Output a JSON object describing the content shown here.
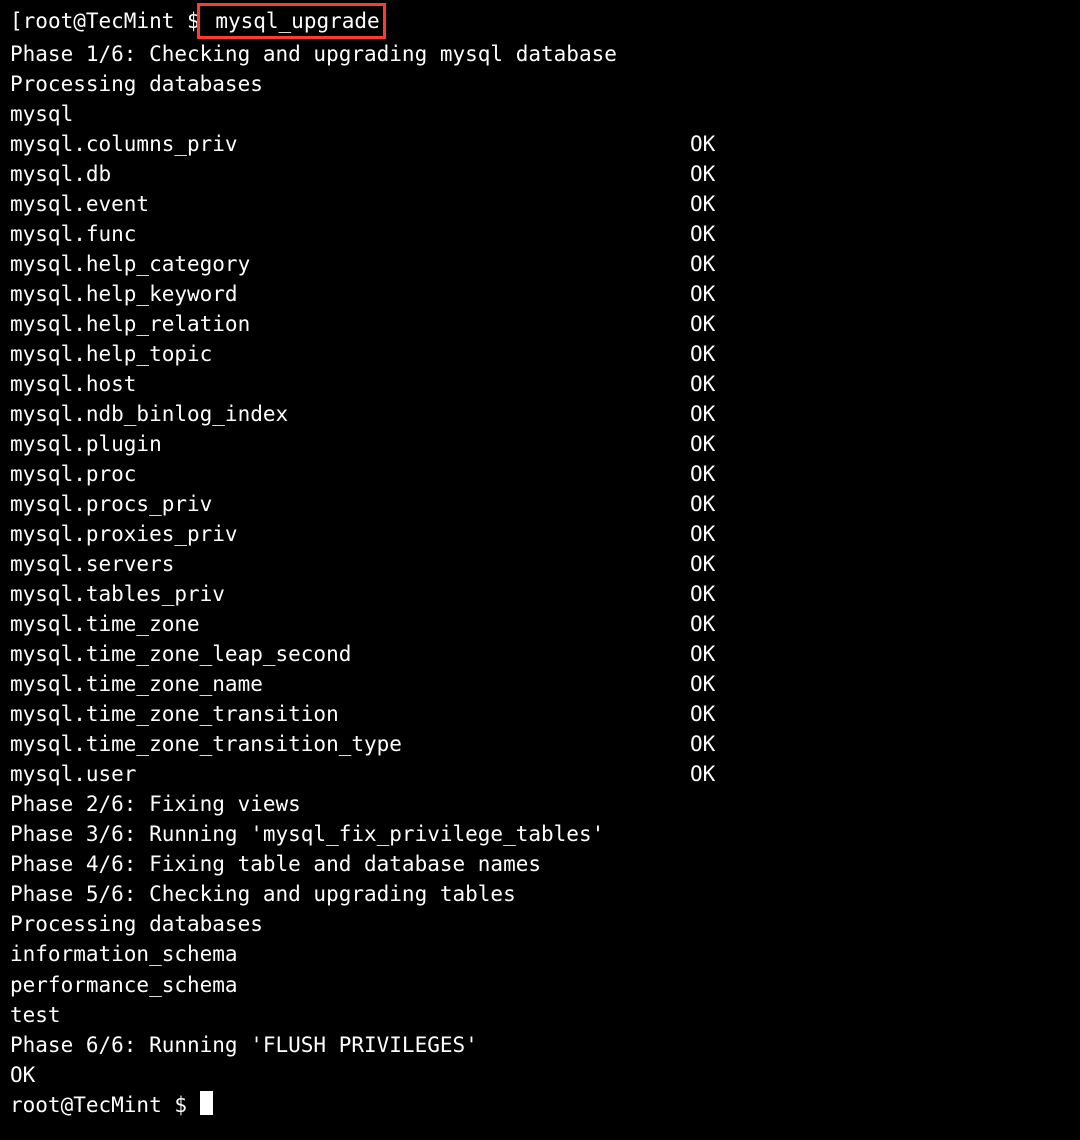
{
  "prompt1": {
    "prefix": "[",
    "user_host": "root@TecMint $",
    "command": " mysql_upgrade"
  },
  "phase1_line": "Phase 1/6: Checking and upgrading mysql database",
  "processing1": "Processing databases",
  "db_mysql": "mysql",
  "tables": [
    {
      "name": "mysql.columns_priv",
      "status": "OK"
    },
    {
      "name": "mysql.db",
      "status": "OK"
    },
    {
      "name": "mysql.event",
      "status": "OK"
    },
    {
      "name": "mysql.func",
      "status": "OK"
    },
    {
      "name": "mysql.help_category",
      "status": "OK"
    },
    {
      "name": "mysql.help_keyword",
      "status": "OK"
    },
    {
      "name": "mysql.help_relation",
      "status": "OK"
    },
    {
      "name": "mysql.help_topic",
      "status": "OK"
    },
    {
      "name": "mysql.host",
      "status": "OK"
    },
    {
      "name": "mysql.ndb_binlog_index",
      "status": "OK"
    },
    {
      "name": "mysql.plugin",
      "status": "OK"
    },
    {
      "name": "mysql.proc",
      "status": "OK"
    },
    {
      "name": "mysql.procs_priv",
      "status": "OK"
    },
    {
      "name": "mysql.proxies_priv",
      "status": "OK"
    },
    {
      "name": "mysql.servers",
      "status": "OK"
    },
    {
      "name": "mysql.tables_priv",
      "status": "OK"
    },
    {
      "name": "mysql.time_zone",
      "status": "OK"
    },
    {
      "name": "mysql.time_zone_leap_second",
      "status": "OK"
    },
    {
      "name": "mysql.time_zone_name",
      "status": "OK"
    },
    {
      "name": "mysql.time_zone_transition",
      "status": "OK"
    },
    {
      "name": "mysql.time_zone_transition_type",
      "status": "OK"
    },
    {
      "name": "mysql.user",
      "status": "OK"
    }
  ],
  "phase2_line": "Phase 2/6: Fixing views",
  "phase3_line": "Phase 3/6: Running 'mysql_fix_privilege_tables'",
  "phase4_line": "Phase 4/6: Fixing table and database names",
  "phase5_line": "Phase 5/6: Checking and upgrading tables",
  "processing2": "Processing databases",
  "db_info_schema": "information_schema",
  "db_perf_schema": "performance_schema",
  "db_test": "test",
  "phase6_line": "Phase 6/6: Running 'FLUSH PRIVILEGES'",
  "final_ok": "OK",
  "prompt2": "root@TecMint $ "
}
